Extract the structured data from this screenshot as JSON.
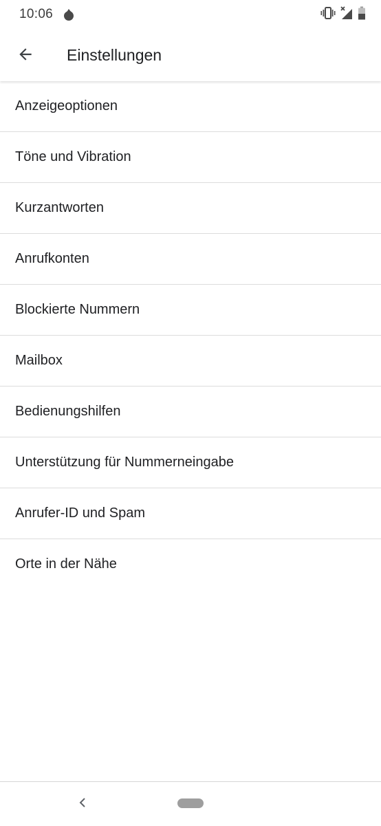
{
  "status_bar": {
    "time": "10:06",
    "icons": [
      "notification-drop-icon",
      "vibrate-icon",
      "no-signal-icon",
      "battery-icon"
    ]
  },
  "app_bar": {
    "back_icon": "arrow-back-icon",
    "title": "Einstellungen"
  },
  "settings": {
    "items": [
      {
        "label": "Anzeigeoptionen"
      },
      {
        "label": "Töne und Vibration"
      },
      {
        "label": "Kurzantworten"
      },
      {
        "label": "Anrufkonten"
      },
      {
        "label": "Blockierte Nummern"
      },
      {
        "label": "Mailbox"
      },
      {
        "label": "Bedienungshilfen"
      },
      {
        "label": "Unterstützung für Nummerneingabe"
      },
      {
        "label": "Anrufer-ID und Spam"
      },
      {
        "label": "Orte in der Nähe"
      }
    ]
  },
  "nav_bar": {
    "icons": [
      "nav-back-icon",
      "nav-home-pill"
    ]
  },
  "colors": {
    "background": "#ffffff",
    "text_primary": "#202124",
    "divider": "#dcdcdc",
    "icon_gray": "#5f6368"
  }
}
